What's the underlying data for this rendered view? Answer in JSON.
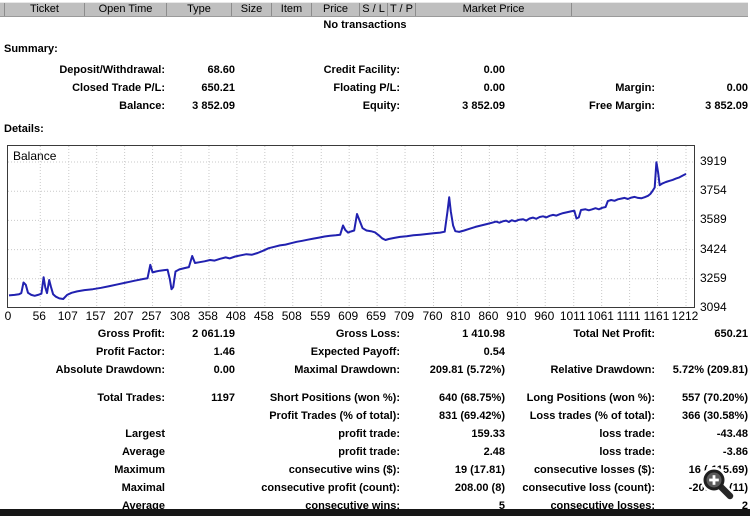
{
  "colors": {
    "line": "#2121b0",
    "grid": "#c9c9c9",
    "header_bg": "#bfbfbf",
    "text": "#000000"
  },
  "table": {
    "columns": [
      "Ticket",
      "Open Time",
      "Type",
      "Size",
      "Item",
      "Price",
      "S / L",
      "T / P",
      "Market Price"
    ],
    "empty_message": "No transactions"
  },
  "summary": {
    "heading": "Summary:",
    "rows": [
      [
        "Deposit/Withdrawal:",
        "68.60",
        "Credit Facility:",
        "0.00",
        "",
        ""
      ],
      [
        "Closed Trade P/L:",
        "650.21",
        "Floating P/L:",
        "0.00",
        "Margin:",
        "0.00"
      ],
      [
        "Balance:",
        "3 852.09",
        "Equity:",
        "3 852.09",
        "Free Margin:",
        "3 852.09"
      ]
    ]
  },
  "details": {
    "heading": "Details:",
    "rows": [
      [
        "Gross Profit:",
        "2 061.19",
        "Gross Loss:",
        "1 410.98",
        "Total Net Profit:",
        "650.21"
      ],
      [
        "Profit Factor:",
        "1.46",
        "Expected Payoff:",
        "0.54",
        "",
        ""
      ],
      [
        "Absolute Drawdown:",
        "0.00",
        "Maximal Drawdown:",
        "209.81 (5.72%)",
        "Relative Drawdown:",
        "5.72% (209.81)"
      ],
      [
        "Total Trades:",
        "1197",
        "Short Positions (won %):",
        "640 (68.75%)",
        "Long Positions (won %):",
        "557 (70.20%)"
      ],
      [
        "",
        "",
        "Profit Trades (% of total):",
        "831 (69.42%)",
        "Loss trades (% of total):",
        "366 (30.58%)"
      ],
      [
        "Largest",
        "",
        "profit trade:",
        "159.33",
        "loss trade:",
        "-43.48"
      ],
      [
        "Average",
        "",
        "profit trade:",
        "2.48",
        "loss trade:",
        "-3.86"
      ],
      [
        "Maximum",
        "",
        "consecutive wins ($):",
        "19 (17.81)",
        "consecutive losses ($):",
        "16 (-115.69)"
      ],
      [
        "Maximal",
        "",
        "consecutive profit (count):",
        "208.00 (8)",
        "consecutive loss (count):",
        "-209.81 (11)"
      ],
      [
        "Average",
        "",
        "consecutive wins:",
        "5",
        "consecutive losses:",
        "2"
      ]
    ]
  },
  "chart_data": {
    "type": "line",
    "title": "Balance",
    "legend_label": "Balance",
    "x_ticks": [
      0,
      56,
      107,
      157,
      207,
      257,
      308,
      358,
      408,
      458,
      508,
      559,
      609,
      659,
      709,
      760,
      810,
      860,
      910,
      960,
      1011,
      1061,
      1111,
      1161,
      1212
    ],
    "y_ticks": [
      3919,
      3754,
      3589,
      3424,
      3259,
      3094
    ],
    "xlim": [
      0,
      1227
    ],
    "ylim": [
      3094,
      4010
    ],
    "grid": true,
    "series": [
      {
        "name": "Balance",
        "points": [
          [
            0,
            3165
          ],
          [
            10,
            3168
          ],
          [
            18,
            3172
          ],
          [
            22,
            3178
          ],
          [
            26,
            3238
          ],
          [
            30,
            3225
          ],
          [
            34,
            3180
          ],
          [
            40,
            3168
          ],
          [
            46,
            3163
          ],
          [
            52,
            3168
          ],
          [
            58,
            3175
          ],
          [
            62,
            3268
          ],
          [
            65,
            3210
          ],
          [
            68,
            3178
          ],
          [
            72,
            3252
          ],
          [
            75,
            3215
          ],
          [
            79,
            3172
          ],
          [
            84,
            3158
          ],
          [
            90,
            3148
          ],
          [
            97,
            3145
          ],
          [
            104,
            3168
          ],
          [
            112,
            3180
          ],
          [
            122,
            3188
          ],
          [
            135,
            3195
          ],
          [
            150,
            3200
          ],
          [
            165,
            3208
          ],
          [
            180,
            3218
          ],
          [
            195,
            3228
          ],
          [
            210,
            3238
          ],
          [
            225,
            3248
          ],
          [
            240,
            3258
          ],
          [
            248,
            3262
          ],
          [
            253,
            3338
          ],
          [
            257,
            3295
          ],
          [
            263,
            3300
          ],
          [
            270,
            3305
          ],
          [
            278,
            3308
          ],
          [
            284,
            3310
          ],
          [
            288,
            3255
          ],
          [
            291,
            3200
          ],
          [
            294,
            3212
          ],
          [
            298,
            3300
          ],
          [
            305,
            3312
          ],
          [
            315,
            3320
          ],
          [
            322,
            3325
          ],
          [
            328,
            3388
          ],
          [
            333,
            3348
          ],
          [
            340,
            3352
          ],
          [
            350,
            3358
          ],
          [
            360,
            3365
          ],
          [
            368,
            3362
          ],
          [
            378,
            3372
          ],
          [
            388,
            3380
          ],
          [
            395,
            3374
          ],
          [
            405,
            3385
          ],
          [
            415,
            3392
          ],
          [
            425,
            3398
          ],
          [
            435,
            3395
          ],
          [
            445,
            3405
          ],
          [
            455,
            3418
          ],
          [
            465,
            3432
          ],
          [
            475,
            3440
          ],
          [
            485,
            3448
          ],
          [
            495,
            3452
          ],
          [
            505,
            3460
          ],
          [
            515,
            3468
          ],
          [
            525,
            3474
          ],
          [
            535,
            3480
          ],
          [
            545,
            3486
          ],
          [
            555,
            3492
          ],
          [
            565,
            3498
          ],
          [
            575,
            3502
          ],
          [
            585,
            3505
          ],
          [
            593,
            3508
          ],
          [
            598,
            3560
          ],
          [
            602,
            3535
          ],
          [
            607,
            3520
          ],
          [
            612,
            3526
          ],
          [
            618,
            3532
          ],
          [
            623,
            3625
          ],
          [
            628,
            3585
          ],
          [
            633,
            3545
          ],
          [
            640,
            3532
          ],
          [
            648,
            3528
          ],
          [
            655,
            3522
          ],
          [
            662,
            3505
          ],
          [
            668,
            3488
          ],
          [
            674,
            3478
          ],
          [
            680,
            3484
          ],
          [
            690,
            3490
          ],
          [
            700,
            3496
          ],
          [
            712,
            3500
          ],
          [
            724,
            3505
          ],
          [
            736,
            3508
          ],
          [
            748,
            3512
          ],
          [
            760,
            3516
          ],
          [
            772,
            3520
          ],
          [
            780,
            3525
          ],
          [
            785,
            3640
          ],
          [
            788,
            3720
          ],
          [
            791,
            3640
          ],
          [
            795,
            3560
          ],
          [
            799,
            3528
          ],
          [
            806,
            3524
          ],
          [
            815,
            3532
          ],
          [
            825,
            3542
          ],
          [
            835,
            3552
          ],
          [
            845,
            3560
          ],
          [
            855,
            3568
          ],
          [
            865,
            3576
          ],
          [
            872,
            3582
          ],
          [
            878,
            3576
          ],
          [
            884,
            3584
          ],
          [
            890,
            3588
          ],
          [
            895,
            3580
          ],
          [
            900,
            3590
          ],
          [
            906,
            3584
          ],
          [
            912,
            3592
          ],
          [
            920,
            3596
          ],
          [
            926,
            3588
          ],
          [
            932,
            3600
          ],
          [
            938,
            3605
          ],
          [
            944,
            3598
          ],
          [
            950,
            3608
          ],
          [
            956,
            3612
          ],
          [
            962,
            3606
          ],
          [
            968,
            3615
          ],
          [
            974,
            3620
          ],
          [
            980,
            3616
          ],
          [
            986,
            3624
          ],
          [
            992,
            3630
          ],
          [
            1000,
            3636
          ],
          [
            1006,
            3640
          ],
          [
            1012,
            3644
          ],
          [
            1016,
            3600
          ],
          [
            1020,
            3606
          ],
          [
            1024,
            3648
          ],
          [
            1032,
            3652
          ],
          [
            1038,
            3646
          ],
          [
            1044,
            3652
          ],
          [
            1050,
            3658
          ],
          [
            1056,
            3652
          ],
          [
            1062,
            3660
          ],
          [
            1068,
            3665
          ],
          [
            1072,
            3698
          ],
          [
            1078,
            3704
          ],
          [
            1084,
            3700
          ],
          [
            1090,
            3708
          ],
          [
            1096,
            3712
          ],
          [
            1102,
            3716
          ],
          [
            1108,
            3710
          ],
          [
            1114,
            3718
          ],
          [
            1120,
            3722
          ],
          [
            1126,
            3716
          ],
          [
            1132,
            3714
          ],
          [
            1138,
            3720
          ],
          [
            1144,
            3728
          ],
          [
            1148,
            3738
          ],
          [
            1152,
            3755
          ],
          [
            1156,
            3775
          ],
          [
            1159,
            3918
          ],
          [
            1162,
            3860
          ],
          [
            1165,
            3788
          ],
          [
            1170,
            3798
          ],
          [
            1176,
            3806
          ],
          [
            1182,
            3812
          ],
          [
            1188,
            3818
          ],
          [
            1194,
            3825
          ],
          [
            1200,
            3832
          ],
          [
            1206,
            3842
          ],
          [
            1212,
            3852
          ]
        ]
      }
    ]
  },
  "icons": {
    "zoom_cursor": "magnifier-plus"
  }
}
